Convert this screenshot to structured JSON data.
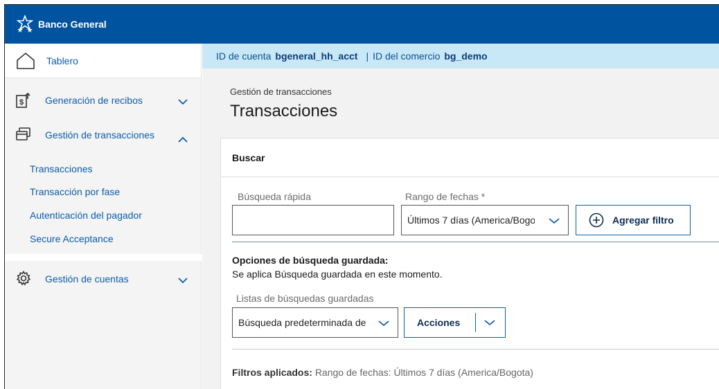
{
  "header": {
    "brand_name": "Banco General"
  },
  "sidebar": {
    "items": [
      {
        "label": "Tablero",
        "icon": "home-icon"
      },
      {
        "label": "Generación de recibos",
        "icon": "receipt-icon",
        "expanded": false
      },
      {
        "label": "Gestión de transacciones",
        "icon": "transactions-icon",
        "expanded": true,
        "children": [
          {
            "label": "Transacciones",
            "active": true
          },
          {
            "label": "Transacción por fase"
          },
          {
            "label": "Autenticación del pagador"
          },
          {
            "label": "Secure Acceptance"
          }
        ]
      },
      {
        "label": "Gestión de cuentas",
        "icon": "gear-icon",
        "expanded": false
      }
    ]
  },
  "infobar": {
    "account_label": "ID de cuenta",
    "account_id": "bgeneral_hh_acct",
    "separator": "|",
    "merchant_label": "ID del comercio",
    "merchant_id": "bg_demo"
  },
  "page": {
    "breadcrumb": "Gestión de transacciones",
    "title": "Transacciones"
  },
  "search_panel": {
    "title": "Buscar",
    "quick_search": {
      "label": "Búsqueda rápida",
      "value": "",
      "placeholder": ""
    },
    "date_range": {
      "label": "Rango de fechas *",
      "value": "Últimos 7 días (America/Bogota)"
    },
    "add_filter_label": "Agregar filtro",
    "saved_options_title": "Opciones de búsqueda guardada:",
    "saved_options_note": "Se aplica Búsqueda guardada en este momento.",
    "saved_list": {
      "label": "Listas de búsquedas guardadas",
      "value": "Búsqueda predeterminada de transacciones"
    },
    "actions_label": "Acciones",
    "applied_filters_label": "Filtros aplicados:",
    "applied_filters_value": "Rango de fechas: Últimos 7 días (America/Bogota)"
  },
  "colors": {
    "topbar": "#00539f",
    "infobar": "#c9e8f7",
    "link": "#0b5cad"
  }
}
